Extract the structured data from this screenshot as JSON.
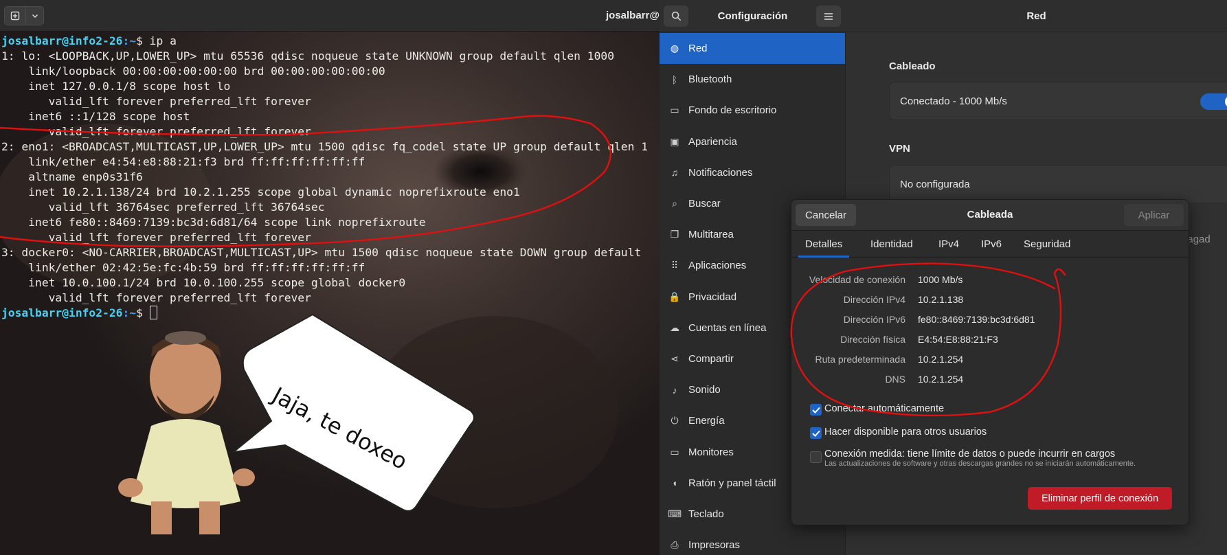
{
  "terminal": {
    "title": "josalbarr@",
    "prompt_user": "josalbarr@info2-26",
    "prompt_path": ":~",
    "command": "$ ip a",
    "lines": [
      "1: lo: <LOOPBACK,UP,LOWER_UP> mtu 65536 qdisc noqueue state UNKNOWN group default qlen 1000",
      "    link/loopback 00:00:00:00:00:00 brd 00:00:00:00:00:00",
      "    inet 127.0.0.1/8 scope host lo",
      "       valid_lft forever preferred_lft forever",
      "    inet6 ::1/128 scope host",
      "       valid_lft forever preferred_lft forever",
      "2: eno1: <BROADCAST,MULTICAST,UP,LOWER_UP> mtu 1500 qdisc fq_codel state UP group default qlen 1",
      "    link/ether e4:54:e8:88:21:f3 brd ff:ff:ff:ff:ff:ff",
      "    altname enp0s31f6",
      "    inet 10.2.1.138/24 brd 10.2.1.255 scope global dynamic noprefixroute eno1",
      "       valid_lft 36764sec preferred_lft 36764sec",
      "    inet6 fe80::8469:7139:bc3d:6d81/64 scope link noprefixroute",
      "       valid_lft forever preferred_lft forever",
      "3: docker0: <NO-CARRIER,BROADCAST,MULTICAST,UP> mtu 1500 qdisc noqueue state DOWN group default",
      "    link/ether 02:42:5e:fc:4b:59 brd ff:ff:ff:ff:ff:ff",
      "    inet 10.0.100.1/24 brd 10.0.100.255 scope global docker0",
      "       valid_lft forever preferred_lft forever"
    ],
    "final_prompt": "$ "
  },
  "meme": {
    "speech": "Jaja, te doxeo"
  },
  "settings": {
    "sidebar_title": "Configuración",
    "items": [
      {
        "label": "Red",
        "icon": "globe-icon",
        "glyph": "◍"
      },
      {
        "label": "Bluetooth",
        "icon": "bluetooth-icon",
        "glyph": "ᛒ"
      },
      {
        "label": "Fondo de escritorio",
        "icon": "display-icon",
        "glyph": "▭"
      },
      {
        "label": "Apariencia",
        "icon": "appearance-icon",
        "glyph": "▣"
      },
      {
        "label": "Notificaciones",
        "icon": "bell-icon",
        "glyph": "♫"
      },
      {
        "label": "Buscar",
        "icon": "search-icon",
        "glyph": "⌕"
      },
      {
        "label": "Multitarea",
        "icon": "multitask-icon",
        "glyph": "❐"
      },
      {
        "label": "Aplicaciones",
        "icon": "apps-grid-icon",
        "glyph": "⠿"
      },
      {
        "label": "Privacidad",
        "icon": "lock-icon",
        "glyph": "🔒"
      },
      {
        "label": "Cuentas en línea",
        "icon": "cloud-icon",
        "glyph": "☁"
      },
      {
        "label": "Compartir",
        "icon": "share-icon",
        "glyph": "⋖"
      },
      {
        "label": "Sonido",
        "icon": "music-note-icon",
        "glyph": "♪"
      },
      {
        "label": "Energía",
        "icon": "power-icon",
        "glyph": "⏻"
      },
      {
        "label": "Monitores",
        "icon": "monitor-icon",
        "glyph": "▭"
      },
      {
        "label": "Ratón y panel táctil",
        "icon": "mouse-icon",
        "glyph": "◖"
      },
      {
        "label": "Teclado",
        "icon": "keyboard-icon",
        "glyph": "⌨"
      },
      {
        "label": "Impresoras",
        "icon": "printer-icon",
        "glyph": "⎙"
      }
    ],
    "content_title": "Red",
    "wired_section": "Cableado",
    "wired_status": "Conectado - 1000 Mb/s",
    "vpn_section": "VPN",
    "vpn_status": "No configurada",
    "apagado": "Apagad"
  },
  "dialog": {
    "title": "Cableada",
    "cancel": "Cancelar",
    "apply": "Aplicar",
    "tabs": [
      "Detalles",
      "Identidad",
      "IPv4",
      "IPv6",
      "Seguridad"
    ],
    "details": [
      {
        "label": "Velocidad de conexión",
        "value": "1000 Mb/s"
      },
      {
        "label": "Dirección IPv4",
        "value": "10.2.1.138"
      },
      {
        "label": "Dirección IPv6",
        "value": "fe80::8469:7139:bc3d:6d81"
      },
      {
        "label": "Dirección física",
        "value": "E4:54:E8:88:21:F3"
      },
      {
        "label": "Ruta predeterminada",
        "value": "10.2.1.254"
      },
      {
        "label": "DNS",
        "value": "10.2.1.254"
      }
    ],
    "auto_connect": "Conectar automáticamente",
    "shared": "Hacer disponible para otros usuarios",
    "metered": "Conexión medida: tiene límite de datos o puede incurrir en cargos",
    "metered_sub": "Las actualizaciones de software y otras descargas grandes no se iniciarán automáticamente.",
    "delete": "Eliminar perfil de conexión"
  },
  "colors": {
    "accent": "#1f63c4",
    "destructive": "#c01c28",
    "annotation": "#e01010"
  }
}
